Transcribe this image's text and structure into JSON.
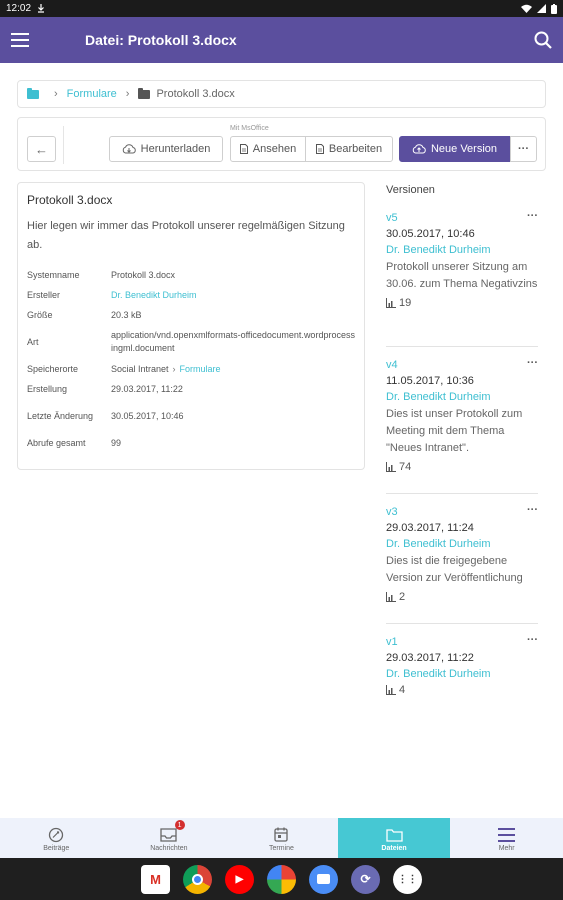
{
  "status_bar": {
    "time": "12:02"
  },
  "appbar": {
    "title": "Datei: Protokoll 3.docx"
  },
  "breadcrumb": {
    "folder": "Formulare",
    "file": "Protokoll 3.docx"
  },
  "toolbar": {
    "download": "Herunterladen",
    "msoffice_label": "Mit MsOffice",
    "view": "Ansehen",
    "edit": "Bearbeiten",
    "new_version": "Neue Version",
    "more": "···"
  },
  "details": {
    "title": "Protokoll 3.docx",
    "description": "Hier legen wir immer das Protokoll unserer regelmäßigen Sitzung ab.",
    "meta": {
      "systemname_label": "Systemname",
      "systemname": "Protokoll 3.docx",
      "creator_label": "Ersteller",
      "creator": "Dr. Benedikt Durheim",
      "size_label": "Größe",
      "size": "20.3 kB",
      "type_label": "Art",
      "type": "application/vnd.openxmlformats-officedocument.wordprocessingml.document",
      "location_label": "Speicherorte",
      "location_root": "Social Intranet",
      "location_folder": "Formulare",
      "created_label": "Erstellung",
      "created": "29.03.2017, 11:22",
      "modified_label": "Letzte Änderung",
      "modified": "30.05.2017, 10:46",
      "views_label": "Abrufe gesamt",
      "views": "99"
    }
  },
  "versions": {
    "heading": "Versionen",
    "items": [
      {
        "name": "v5",
        "date": "30.05.2017, 10:46",
        "author": "Dr. Benedikt Durheim",
        "description": "Protokoll unserer Sitzung am 30.06. zum Thema Negativzins",
        "views": "19"
      },
      {
        "name": "v4",
        "date": "11.05.2017, 10:36",
        "author": "Dr. Benedikt Durheim",
        "description": "Dies ist unser Protokoll zum Meeting mit dem Thema \"Neues Intranet\".",
        "views": "74"
      },
      {
        "name": "v3",
        "date": "29.03.2017, 11:24",
        "author": "Dr. Benedikt Durheim",
        "description": "Dies ist die freigegebene Version zur Veröffentlichung",
        "views": "2"
      },
      {
        "name": "v1",
        "date": "29.03.2017, 11:22",
        "author": "Dr. Benedikt Durheim",
        "description": "",
        "views": "4"
      }
    ]
  },
  "bottom_nav": {
    "items": [
      {
        "label": "Beiträge",
        "icon": "posts-icon"
      },
      {
        "label": "Nachrichten",
        "icon": "inbox-icon",
        "badge": "1"
      },
      {
        "label": "Termine",
        "icon": "calendar-icon"
      },
      {
        "label": "Dateien",
        "icon": "folder-icon",
        "active": true
      },
      {
        "label": "Mehr",
        "icon": "menu-icon"
      }
    ]
  },
  "colors": {
    "primary": "#5b4f9e",
    "accent": "#3ebfd1",
    "nav_active": "#46c8d3"
  }
}
